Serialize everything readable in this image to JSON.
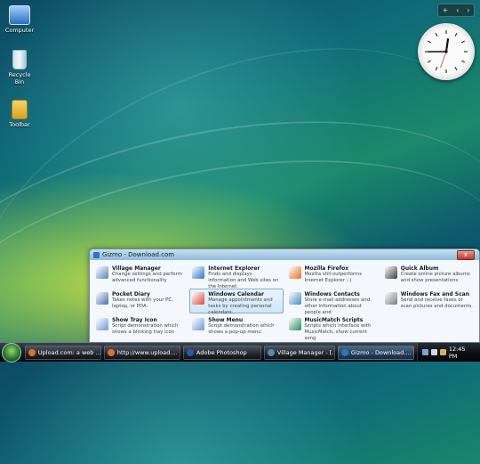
{
  "desktop": {
    "icons": [
      {
        "label": "Computer",
        "icon": "computer-icon"
      },
      {
        "label": "Recycle Bin",
        "icon": "recycle-bin-icon"
      },
      {
        "label": "Toolbar",
        "icon": "folder-icon"
      }
    ]
  },
  "sidebar_gadgets": {
    "controls": [
      "+",
      "‹",
      "›"
    ],
    "clock": {
      "time": "12:45 PM"
    }
  },
  "gizmo_window": {
    "title": "Gizmo - Download.com",
    "close_label": "x",
    "items": [
      {
        "title": "Village Manager",
        "desc": "Change settings and perform advanced functionality",
        "icon": "gears-icon",
        "color": "#5a86b8"
      },
      {
        "title": "Internet Explorer",
        "desc": "Finds and displays information and Web sites on the Internet.",
        "icon": "ie-icon",
        "color": "#2b74d0"
      },
      {
        "title": "Mozilla Firefox",
        "desc": "Mozilla still outperforms Internet Explorer ;-)",
        "icon": "firefox-icon",
        "color": "#e0702a"
      },
      {
        "title": "Quick Album",
        "desc": "Create online picture albums and show presentations",
        "icon": "camera-icon",
        "color": "#3a3a3a"
      },
      {
        "title": "Pocket Diary",
        "desc": "Takes notes with your PC, laptop, or PDA.",
        "icon": "diary-icon",
        "color": "#4a6ea8"
      },
      {
        "title": "Windows Calendar",
        "desc": "Manage appointments and tasks by creating personal calendars.",
        "icon": "calendar-icon",
        "color": "#d94a3a",
        "selected": true
      },
      {
        "title": "Windows Contacts",
        "desc": "Store e-mail addresses and other information about people and",
        "icon": "contacts-icon",
        "color": "#4d8ac6"
      },
      {
        "title": "Windows Fax and Scan",
        "desc": "Send and receive faxes or scan pictures and documents.",
        "icon": "fax-icon",
        "color": "#7a7a7a"
      },
      {
        "title": "Show Tray Icon",
        "desc": "Script demonstration which shows a blinking tray icon",
        "icon": "script-icon",
        "color": "#6a9ad0"
      },
      {
        "title": "Show Menu",
        "desc": "Script demonstration which shows a pop-up menu",
        "icon": "script-icon",
        "color": "#6a9ad0"
      },
      {
        "title": "MusicMatch Scripts",
        "desc": "Scripts which interface with MusicMatch, show current song",
        "icon": "music-icon",
        "color": "#2a8a5a"
      }
    ]
  },
  "taskbar": {
    "tasks": [
      {
        "label": "Upload.com: a web ...",
        "icon": "firefox-icon",
        "color": "#e0702a"
      },
      {
        "label": "http://www.upload....",
        "icon": "firefox-icon",
        "color": "#e0702a"
      },
      {
        "label": "Adobe Photoshop",
        "icon": "photoshop-icon",
        "color": "#2a5aa8"
      },
      {
        "label": "Village Manager - [...",
        "icon": "gears-icon",
        "color": "#5a86b8"
      },
      {
        "label": "Gizmo - Download....",
        "icon": "gizmo-icon",
        "color": "#2f74c0",
        "active": true
      }
    ],
    "clock": "12:45 PM"
  }
}
